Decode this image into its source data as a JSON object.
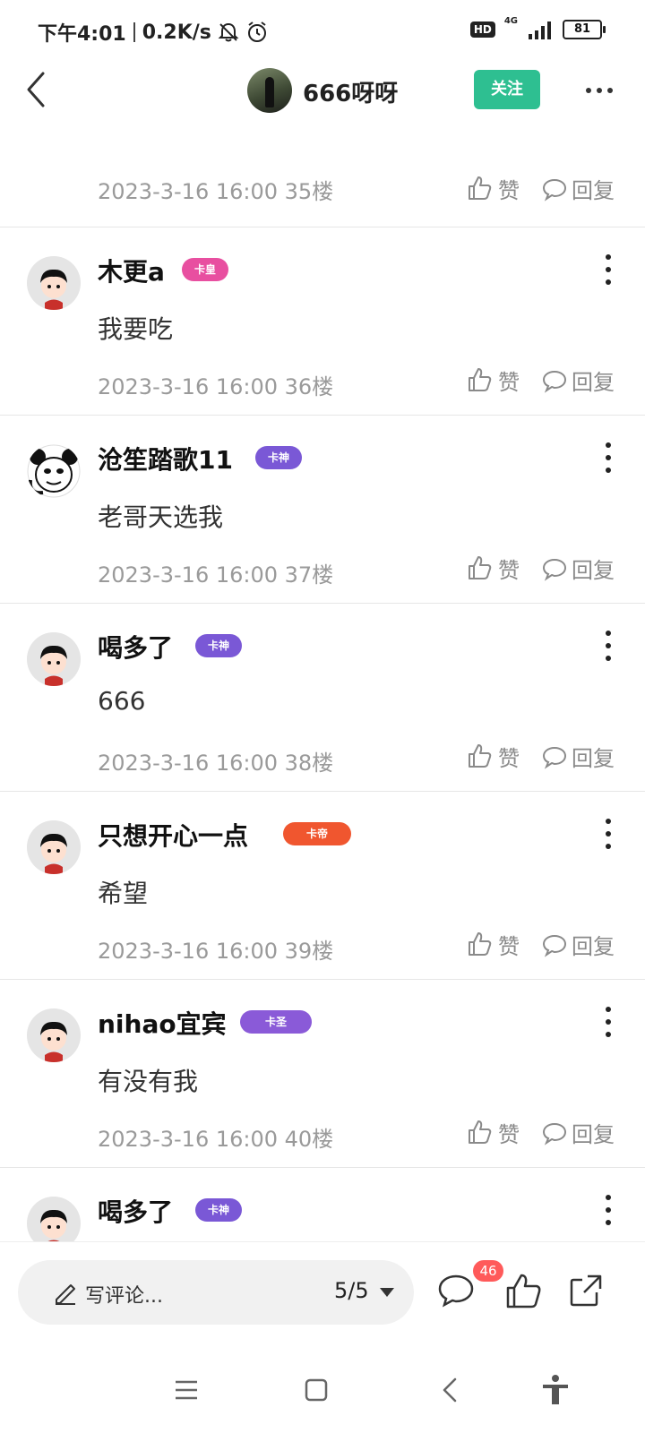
{
  "status_bar": {
    "time": "下午4:01",
    "speed": "0.2K/s",
    "hd_label": "HD",
    "network_label": "4G",
    "battery": "81",
    "icons": [
      "mute-bell-icon",
      "alarm-icon",
      "signal-icon"
    ]
  },
  "nav": {
    "title": "666呀呀",
    "follow_label": "关注"
  },
  "actions": {
    "like_label": "赞",
    "reply_label": "回复"
  },
  "first_meta": "2023-3-16 16:00  35楼",
  "comments": [
    {
      "name": "木更a",
      "badge": "卡皇",
      "badge_color": "#e84fa0",
      "text": "我要吃",
      "meta": "2023-3-16 16:00  36楼"
    },
    {
      "name": "沧笙踏歌11",
      "badge": "卡神",
      "badge_color": "#7a58d6",
      "text": "老哥天选我",
      "meta": "2023-3-16 16:00  37楼"
    },
    {
      "name": "喝多了",
      "badge": "卡神",
      "badge_color": "#7a58d6",
      "text": "666",
      "meta": "2023-3-16 16:00  38楼"
    },
    {
      "name": "只想开心一点",
      "badge": "卡帝",
      "badge_color": "#f0562f",
      "text": "希望",
      "meta": "2023-3-16 16:00  39楼"
    },
    {
      "name": "nihao宜宾",
      "badge": "卡圣",
      "badge_color": "#8a5ad8",
      "text": "有没有我",
      "meta": "2023-3-16 16:00  40楼"
    },
    {
      "name": "喝多了",
      "badge": "卡神",
      "badge_color": "#7a58d6",
      "text": "",
      "meta": ""
    }
  ],
  "bottom": {
    "placeholder": "写评论...",
    "page_indicator": "5/5",
    "comment_count": "46"
  },
  "colors": {
    "accent": "#2ebf91",
    "badge_red": "#ff5a5a"
  }
}
